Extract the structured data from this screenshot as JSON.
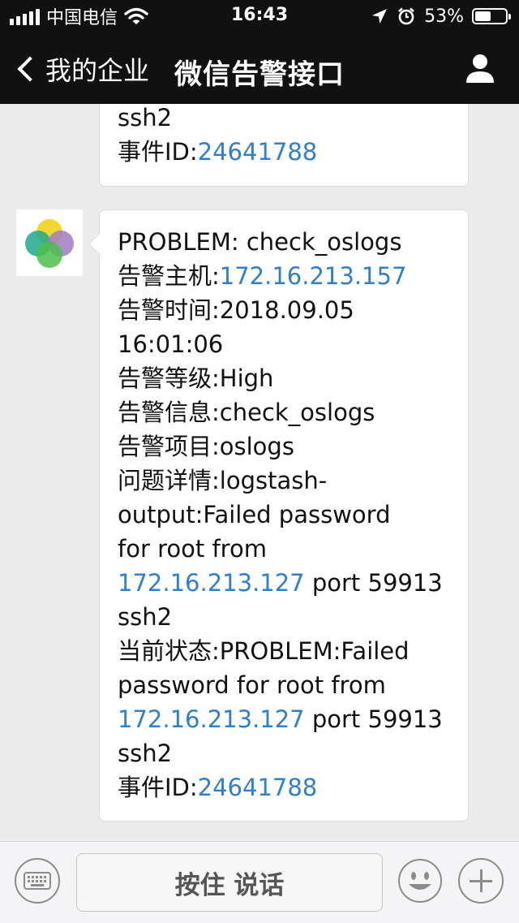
{
  "status_bar": {
    "carrier": "中国电信",
    "time": "16:43",
    "battery_percent": "53%",
    "battery_level": 0.53
  },
  "nav": {
    "back_label": "我的企业",
    "title": "微信告警接口"
  },
  "messages": [
    {
      "lines": [
        [
          {
            "text": "ssh2",
            "link": false
          }
        ],
        [
          {
            "text": "事件ID:",
            "link": false
          },
          {
            "text": "24641788",
            "link": true
          }
        ]
      ]
    },
    {
      "lines": [
        [
          {
            "text": "PROBLEM: check_oslogs",
            "link": false
          }
        ],
        [
          {
            "text": "告警主机:",
            "link": false
          },
          {
            "text": "172.16.213.157",
            "link": true
          }
        ],
        [
          {
            "text": "告警时间:2018.09.05",
            "link": false
          }
        ],
        [
          {
            "text": "16:01:06",
            "link": false
          }
        ],
        [
          {
            "text": "告警等级:High",
            "link": false
          }
        ],
        [
          {
            "text": "告警信息:check_oslogs",
            "link": false
          }
        ],
        [
          {
            "text": "告警项目:oslogs",
            "link": false
          }
        ],
        [
          {
            "text": "问题详情:logstash-",
            "link": false
          }
        ],
        [
          {
            "text": "output:Failed password",
            "link": false
          }
        ],
        [
          {
            "text": "for root from",
            "link": false
          }
        ],
        [
          {
            "text": "172.16.213.127",
            "link": true
          },
          {
            "text": " port 59913",
            "link": false
          }
        ],
        [
          {
            "text": " ssh2",
            "link": false
          }
        ],
        [
          {
            "text": "当前状态:PROBLEM:Failed",
            "link": false
          }
        ],
        [
          {
            "text": " password for root from",
            "link": false
          }
        ],
        [
          {
            "text": "172.16.213.127",
            "link": true
          },
          {
            "text": " port 59913",
            "link": false
          }
        ],
        [
          {
            "text": " ssh2",
            "link": false
          }
        ],
        [
          {
            "text": "事件ID:",
            "link": false
          },
          {
            "text": "24641788",
            "link": true
          }
        ]
      ]
    }
  ],
  "input_bar": {
    "voice_label": "按住 说话"
  },
  "colors": {
    "link": "#2f7fcc",
    "header_bg": "#111111",
    "chat_bg": "#ebebeb"
  }
}
